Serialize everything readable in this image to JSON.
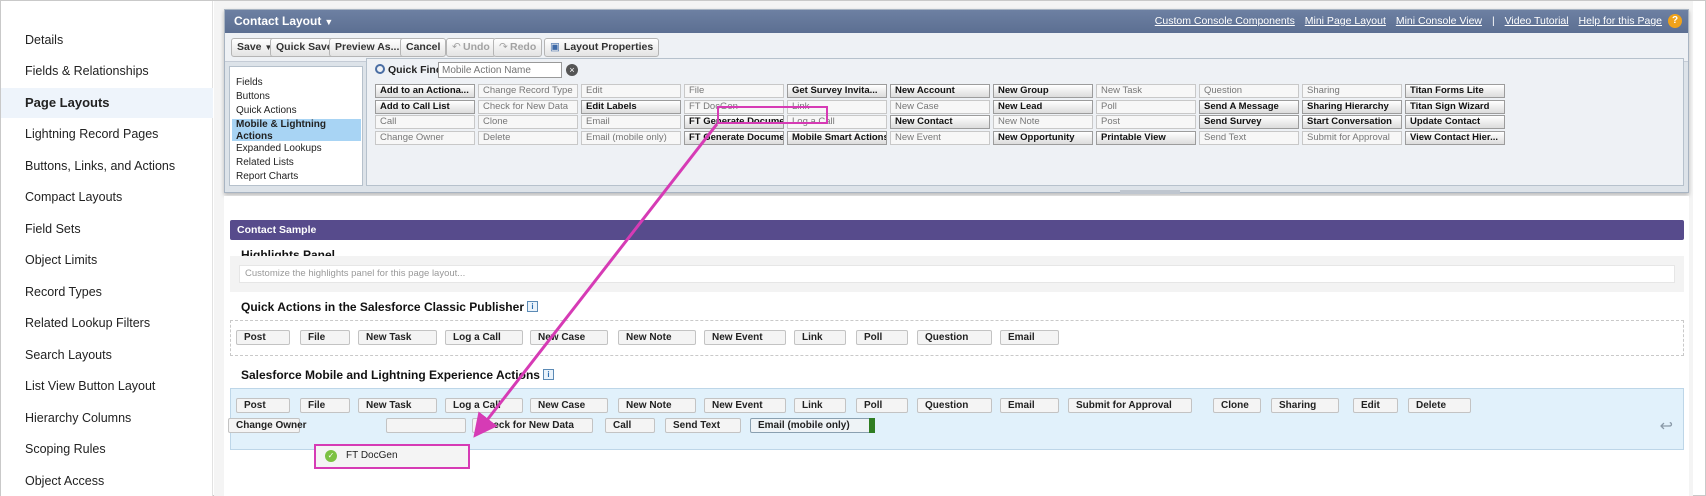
{
  "sidebar": {
    "items": [
      {
        "label": "Details",
        "active": false
      },
      {
        "label": "Fields & Relationships",
        "active": false
      },
      {
        "label": "Page Layouts",
        "active": true
      },
      {
        "label": "Lightning Record Pages",
        "active": false
      },
      {
        "label": "Buttons, Links, and Actions",
        "active": false
      },
      {
        "label": "Compact Layouts",
        "active": false
      },
      {
        "label": "Field Sets",
        "active": false
      },
      {
        "label": "Object Limits",
        "active": false
      },
      {
        "label": "Record Types",
        "active": false
      },
      {
        "label": "Related Lookup Filters",
        "active": false
      },
      {
        "label": "Search Layouts",
        "active": false
      },
      {
        "label": "List View Button Layout",
        "active": false
      },
      {
        "label": "Hierarchy Columns",
        "active": false
      },
      {
        "label": "Scoping Rules",
        "active": false
      },
      {
        "label": "Object Access",
        "active": false
      }
    ]
  },
  "editor": {
    "title": "Contact Layout",
    "links": [
      "Custom Console Components",
      "Mini Page Layout",
      "Mini Console View",
      "Video Tutorial",
      "Help for this Page"
    ],
    "link_separator": "|",
    "help_icon_glyph": "?",
    "toolbar": {
      "save": "Save",
      "quick_save": "Quick Save",
      "preview_as": "Preview As...",
      "cancel": "Cancel",
      "undo": "Undo",
      "redo": "Redo",
      "layout_properties": "Layout Properties"
    }
  },
  "palette": {
    "categories": [
      "Fields",
      "Buttons",
      "Quick Actions",
      "Mobile & Lightning Actions",
      "Expanded Lookups",
      "Related Lists",
      "Report Charts"
    ],
    "selected_category": "Mobile & Lightning Actions",
    "quick_find_label": "Quick Find",
    "quick_find_placeholder": "Mobile Action Name",
    "clear_glyph": "×",
    "columns": [
      [
        {
          "label": "Add to an Actiona...",
          "available": true
        },
        {
          "label": "Add to Call List",
          "available": true
        },
        {
          "label": "Call",
          "available": false
        },
        {
          "label": "Change Owner",
          "available": false
        }
      ],
      [
        {
          "label": "Change Record Type",
          "available": false
        },
        {
          "label": "Check for New Data",
          "available": false
        },
        {
          "label": "Clone",
          "available": false
        },
        {
          "label": "Delete",
          "available": false
        }
      ],
      [
        {
          "label": "Edit",
          "available": false
        },
        {
          "label": "Edit Labels",
          "available": true
        },
        {
          "label": "Email",
          "available": false
        },
        {
          "label": "Email (mobile only)",
          "available": false
        }
      ],
      [
        {
          "label": "File",
          "available": false
        },
        {
          "label": "FT DocGen",
          "available": false
        },
        {
          "label": "FT Generate Document",
          "available": true
        },
        {
          "label": "FT Generate Document",
          "available": true
        }
      ],
      [
        {
          "label": "Get Survey Invita...",
          "available": true
        },
        {
          "label": "Link",
          "available": false
        },
        {
          "label": "Log a Call",
          "available": false
        },
        {
          "label": "Mobile Smart Actions",
          "available": true
        }
      ],
      [
        {
          "label": "New Account",
          "available": true
        },
        {
          "label": "New Case",
          "available": false
        },
        {
          "label": "New Contact",
          "available": true
        },
        {
          "label": "New Event",
          "available": false
        }
      ],
      [
        {
          "label": "New Group",
          "available": true
        },
        {
          "label": "New Lead",
          "available": true
        },
        {
          "label": "New Note",
          "available": false
        },
        {
          "label": "New Opportunity",
          "available": true
        }
      ],
      [
        {
          "label": "New Task",
          "available": false
        },
        {
          "label": "Poll",
          "available": false
        },
        {
          "label": "Post",
          "available": false
        },
        {
          "label": "Printable View",
          "available": true
        }
      ],
      [
        {
          "label": "Question",
          "available": false
        },
        {
          "label": "Send A Message",
          "available": true
        },
        {
          "label": "Send Survey",
          "available": true
        },
        {
          "label": "Send Text",
          "available": false
        }
      ],
      [
        {
          "label": "Sharing",
          "available": false
        },
        {
          "label": "Sharing Hierarchy",
          "available": true
        },
        {
          "label": "Start Conversation",
          "available": true
        },
        {
          "label": "Submit for Approval",
          "available": false
        }
      ],
      [
        {
          "label": "Titan Forms Lite",
          "available": true
        },
        {
          "label": "Titan Sign Wizard",
          "available": true
        },
        {
          "label": "Update Contact",
          "available": true
        },
        {
          "label": "View Contact Hier...",
          "available": true
        }
      ]
    ]
  },
  "sample": {
    "header": "Contact Sample",
    "highlights_title": "Highlights Panel",
    "highlights_placeholder": "Customize the highlights panel for this page layout...",
    "classic_title": "Quick Actions in the Salesforce Classic Publisher",
    "classic_actions": [
      "Post",
      "File",
      "New Task",
      "Log a Call",
      "New Case",
      "New Note",
      "New Event",
      "Link",
      "Poll",
      "Question",
      "Email"
    ],
    "mobile_title": "Salesforce Mobile and Lightning Experience Actions",
    "mobile_row1": [
      "Post",
      "File",
      "New Task",
      "Log a Call",
      "New Case",
      "New Note",
      "New Event",
      "Link",
      "Poll",
      "Question",
      "Email",
      "Submit for Approval",
      "Clone",
      "Sharing",
      "Edit",
      "Delete"
    ],
    "mobile_row2": [
      "Change Owner",
      "",
      "Check for New Data",
      "Call",
      "Send Text",
      "Email (mobile only)"
    ],
    "info_glyph": "i",
    "undo_glyph": "↩"
  },
  "drag": {
    "label": "FT DocGen",
    "check_glyph": "✓",
    "highlight_color": "#d63bb5"
  },
  "colors": {
    "titlebar": "#6d80a2",
    "sample_header": "#574b8c",
    "mobile_zone": "#e1f1fb",
    "annotation": "#d63bb5"
  }
}
